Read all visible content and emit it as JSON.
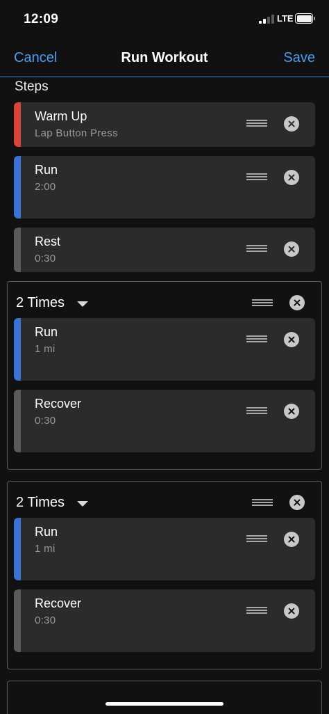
{
  "status_bar": {
    "time": "12:09",
    "network": "LTE"
  },
  "nav": {
    "cancel_label": "Cancel",
    "title": "Run Workout",
    "save_label": "Save"
  },
  "steps_label": "Steps",
  "steps": [
    {
      "name": "Warm Up",
      "detail": "Lap Button Press",
      "color": "#d9453a"
    },
    {
      "name": "Run",
      "detail": "2:00",
      "color": "#3a72d6"
    },
    {
      "name": "Rest",
      "detail": "0:30",
      "color": "#5a5a5a"
    }
  ],
  "repeat_groups": [
    {
      "label": "2 Times",
      "steps": [
        {
          "name": "Run",
          "detail": "1 mi",
          "color": "#3a72d6"
        },
        {
          "name": "Recover",
          "detail": "0:30",
          "color": "#5a5a5a"
        }
      ]
    },
    {
      "label": "2 Times",
      "steps": [
        {
          "name": "Run",
          "detail": "1 mi",
          "color": "#3a72d6"
        },
        {
          "name": "Recover",
          "detail": "0:30",
          "color": "#5a5a5a"
        }
      ]
    }
  ],
  "colors": {
    "accent": "#4a9df0",
    "background": "#111111",
    "card": "#2b2b2b",
    "warmup": "#d9453a",
    "run": "#3a72d6",
    "rest": "#5a5a5a"
  }
}
